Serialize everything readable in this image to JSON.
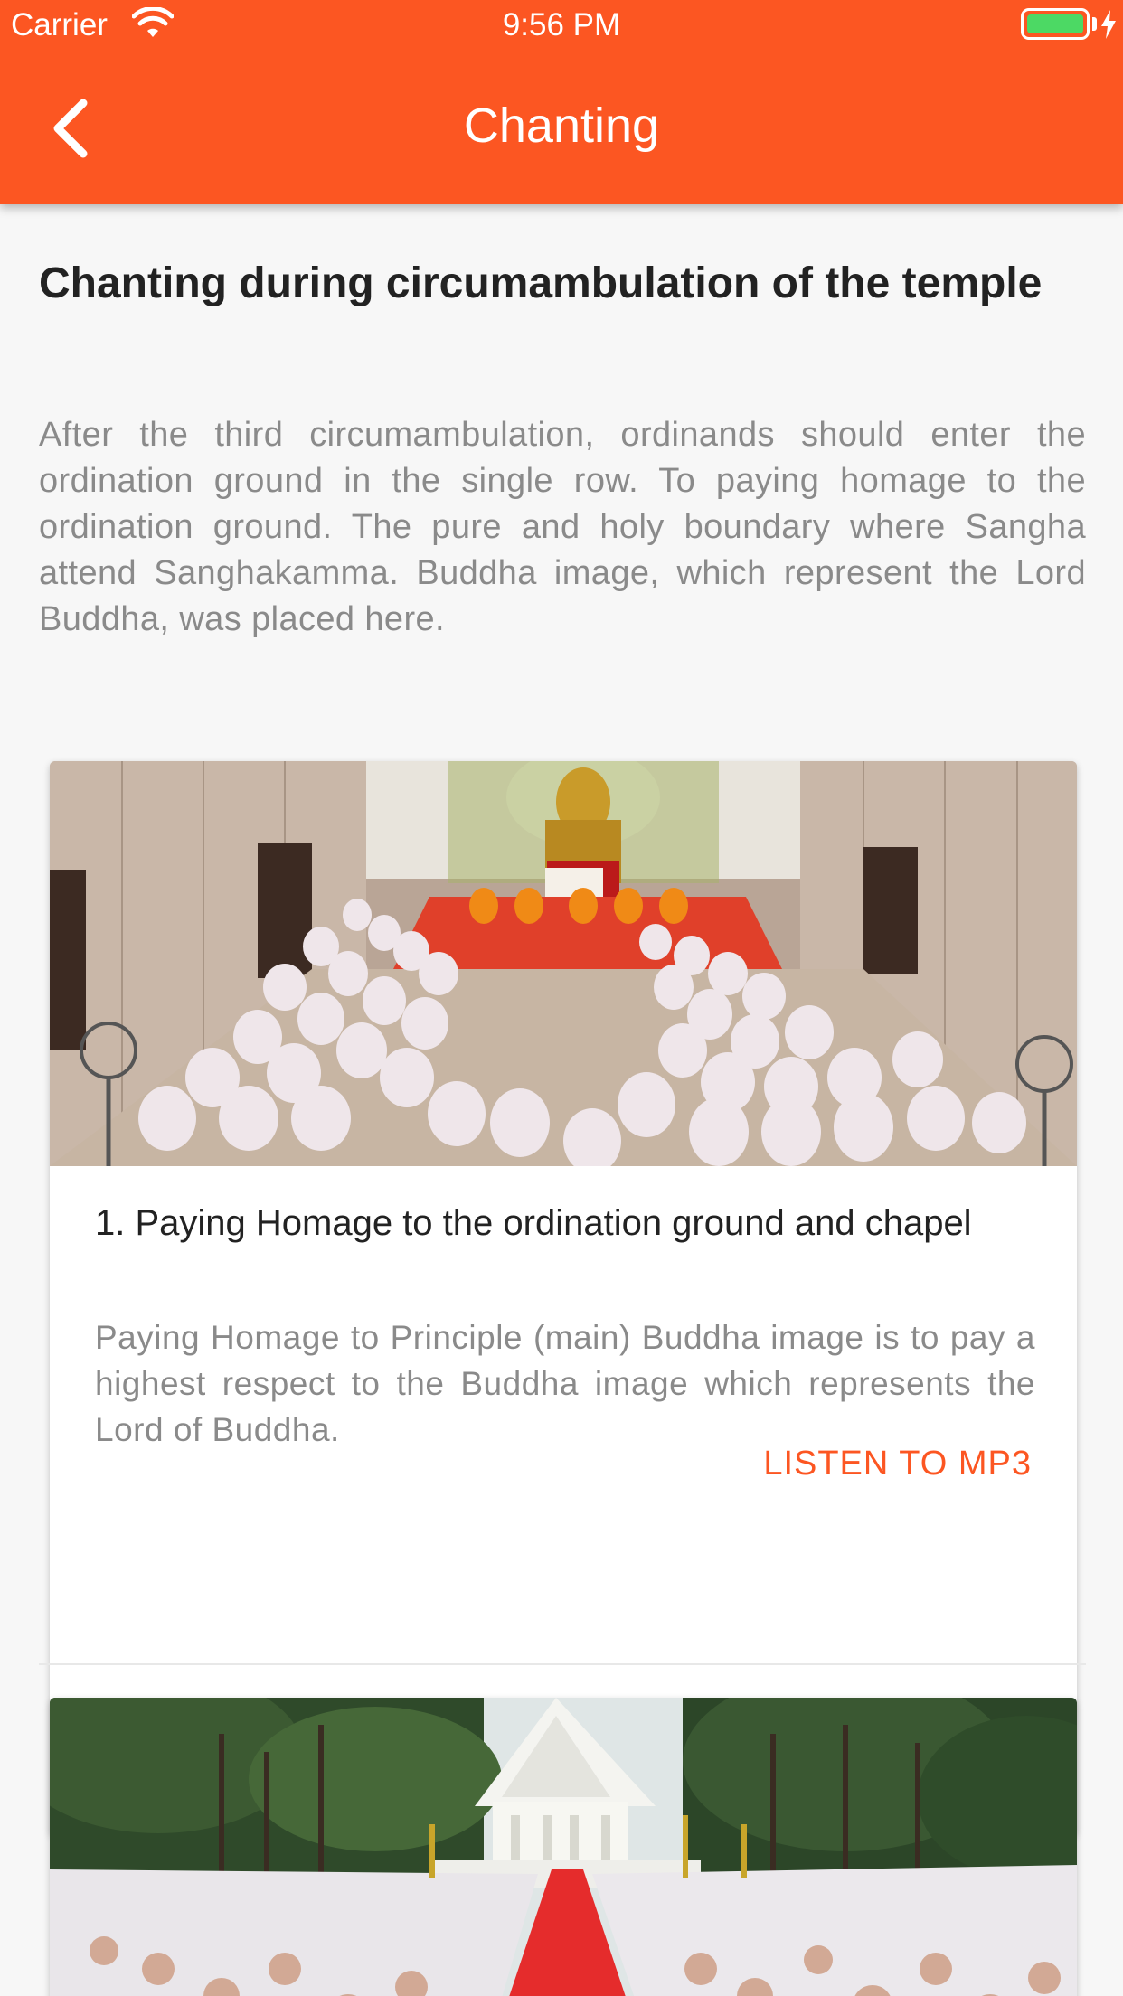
{
  "status_bar": {
    "carrier": "Carrier",
    "time": "9:56 PM",
    "wifi_icon": "wifi-icon",
    "battery_icon": "battery-icon",
    "battery_color": "#4cd964"
  },
  "nav": {
    "title": "Chanting",
    "back_icon": "chevron-left-icon",
    "background_color": "#fc5622"
  },
  "section": {
    "title": "Chanting during circumambulation of the temple",
    "body": "After the third circumambulation, ordinands should enter the ordination ground in the single row. To paying homage to the ordination ground. The pure and holy boundary where Sangha attend Sanghakamma. Buddha image, which represent the Lord Buddha, was placed here."
  },
  "cards": [
    {
      "image": "photo-monks-in-chapel",
      "title": "1. Paying Homage to the ordination ground and chapel",
      "description": "Paying Homage to Principle (main) Buddha image is to pay a highest respect to the Buddha image which represents the Lord of Buddha.",
      "button_label": "LISTEN TO MP3"
    },
    {
      "image": "photo-procession-to-temple"
    }
  ],
  "accent_color": "#fc5622"
}
